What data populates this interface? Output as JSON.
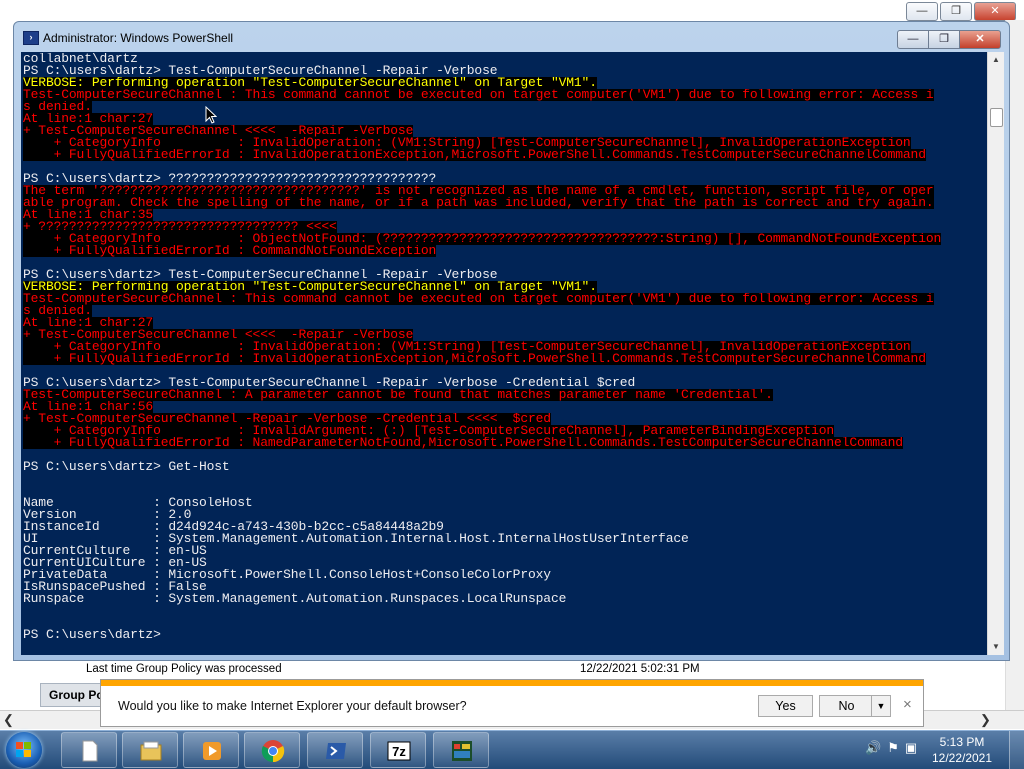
{
  "background_window": {
    "gp_label": "Last time Group Policy was processed",
    "gp_value": "12/22/2021 5:02:31 PM",
    "tab_label": "Group Policy"
  },
  "powershell": {
    "title": "Administrator: Windows PowerShell",
    "lines": [
      {
        "t": "collabnet\\dartz",
        "k": "n"
      },
      {
        "t": "PS C:\\users\\dartz> Test-ComputerSecureChannel -Repair -Verbose",
        "k": "n"
      },
      {
        "t": "VERBOSE: Performing operation \"Test-ComputerSecureChannel\" on Target \"VM1\".",
        "k": "verb"
      },
      {
        "t": "Test-ComputerSecureChannel : This command cannot be executed on target computer('VM1') due to following error: Access i",
        "k": "err"
      },
      {
        "t": "s denied.",
        "k": "err"
      },
      {
        "t": "At line:1 char:27",
        "k": "err"
      },
      {
        "t": "+ Test-ComputerSecureChannel <<<<  -Repair -Verbose",
        "k": "err"
      },
      {
        "t": "    + CategoryInfo          : InvalidOperation: (VM1:String) [Test-ComputerSecureChannel], InvalidOperationException",
        "k": "err"
      },
      {
        "t": "    + FullyQualifiedErrorId : InvalidOperationException,Microsoft.PowerShell.Commands.TestComputerSecureChannelCommand",
        "k": "err"
      },
      {
        "t": "",
        "k": "n"
      },
      {
        "t": "PS C:\\users\\dartz> ???????????????????????????????????",
        "k": "n"
      },
      {
        "t": "The term '??????????????????????????????????' is not recognized as the name of a cmdlet, function, script file, or oper",
        "k": "err"
      },
      {
        "t": "able program. Check the spelling of the name, or if a path was included, verify that the path is correct and try again.",
        "k": "err"
      },
      {
        "t": "At line:1 char:35",
        "k": "err"
      },
      {
        "t": "+ ?????????????????????????????????? <<<<",
        "k": "err"
      },
      {
        "t": "    + CategoryInfo          : ObjectNotFound: (????????????????????????????????????:String) [], CommandNotFoundException",
        "k": "err"
      },
      {
        "t": "    + FullyQualifiedErrorId : CommandNotFoundException",
        "k": "err"
      },
      {
        "t": "",
        "k": "n"
      },
      {
        "t": "PS C:\\users\\dartz> Test-ComputerSecureChannel -Repair -Verbose",
        "k": "n"
      },
      {
        "t": "VERBOSE: Performing operation \"Test-ComputerSecureChannel\" on Target \"VM1\".",
        "k": "verb"
      },
      {
        "t": "Test-ComputerSecureChannel : This command cannot be executed on target computer('VM1') due to following error: Access i",
        "k": "err"
      },
      {
        "t": "s denied.",
        "k": "err"
      },
      {
        "t": "At line:1 char:27",
        "k": "err"
      },
      {
        "t": "+ Test-ComputerSecureChannel <<<<  -Repair -Verbose",
        "k": "err"
      },
      {
        "t": "    + CategoryInfo          : InvalidOperation: (VM1:String) [Test-ComputerSecureChannel], InvalidOperationException",
        "k": "err"
      },
      {
        "t": "    + FullyQualifiedErrorId : InvalidOperationException,Microsoft.PowerShell.Commands.TestComputerSecureChannelCommand",
        "k": "err"
      },
      {
        "t": "",
        "k": "n"
      },
      {
        "t": "PS C:\\users\\dartz> Test-ComputerSecureChannel -Repair -Verbose -Credential $cred",
        "k": "n"
      },
      {
        "t": "Test-ComputerSecureChannel : A parameter cannot be found that matches parameter name 'Credential'.",
        "k": "err"
      },
      {
        "t": "At line:1 char:56",
        "k": "err"
      },
      {
        "t": "+ Test-ComputerSecureChannel -Repair -Verbose -Credential <<<<  $cred",
        "k": "err"
      },
      {
        "t": "    + CategoryInfo          : InvalidArgument: (:) [Test-ComputerSecureChannel], ParameterBindingException",
        "k": "err"
      },
      {
        "t": "    + FullyQualifiedErrorId : NamedParameterNotFound,Microsoft.PowerShell.Commands.TestComputerSecureChannelCommand",
        "k": "err"
      },
      {
        "t": "",
        "k": "n"
      },
      {
        "t": "PS C:\\users\\dartz> Get-Host",
        "k": "n"
      },
      {
        "t": "",
        "k": "n"
      },
      {
        "t": "",
        "k": "n"
      },
      {
        "t": "Name             : ConsoleHost",
        "k": "n"
      },
      {
        "t": "Version          : 2.0",
        "k": "n"
      },
      {
        "t": "InstanceId       : d24d924c-a743-430b-b2cc-c5a84448a2b9",
        "k": "n"
      },
      {
        "t": "UI               : System.Management.Automation.Internal.Host.InternalHostUserInterface",
        "k": "n"
      },
      {
        "t": "CurrentCulture   : en-US",
        "k": "n"
      },
      {
        "t": "CurrentUICulture : en-US",
        "k": "n"
      },
      {
        "t": "PrivateData      : Microsoft.PowerShell.ConsoleHost+ConsoleColorProxy",
        "k": "n"
      },
      {
        "t": "IsRunspacePushed : False",
        "k": "n"
      },
      {
        "t": "Runspace         : System.Management.Automation.Runspaces.LocalRunspace",
        "k": "n"
      },
      {
        "t": "",
        "k": "n"
      },
      {
        "t": "",
        "k": "n"
      },
      {
        "t": "PS C:\\users\\dartz>",
        "k": "n"
      }
    ],
    "colors": {
      "console_bg": "#012456",
      "text": "#eeedf0",
      "error": "#ff0000",
      "verbose": "#ffff00"
    }
  },
  "notification": {
    "message": "Would you like to make Internet Explorer your default browser?",
    "yes_label": "Yes",
    "no_label": "No",
    "close_glyph": "×",
    "accent_color": "#ffa500"
  },
  "taskbar": {
    "apps": [
      "file-icon",
      "windows-explorer-icon",
      "media-player-icon",
      "chrome-icon",
      "powershell-icon",
      "7zip-icon",
      "app-icon"
    ],
    "time": "5:13 PM",
    "date": "12/22/2021",
    "sevenzip_label": "7z"
  },
  "window_controls": {
    "minimize": "—",
    "maximize": "❐",
    "close": "✕"
  }
}
